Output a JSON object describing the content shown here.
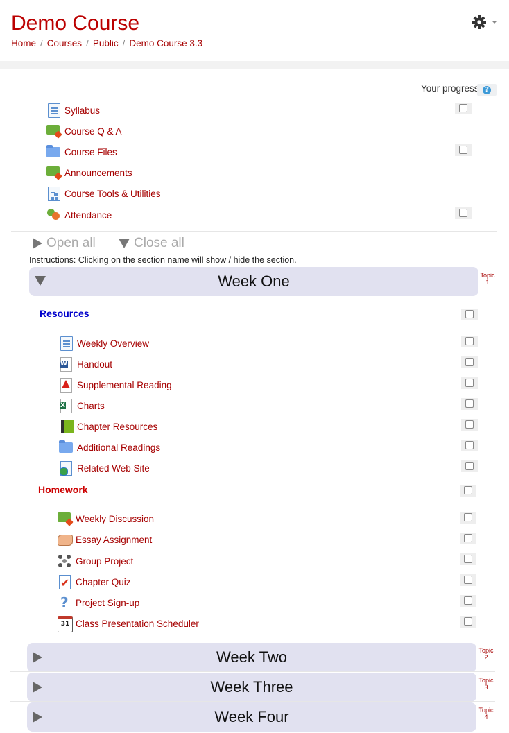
{
  "header": {
    "title": "Demo Course",
    "breadcrumb": [
      "Home",
      "Courses",
      "Public",
      "Demo Course 3.3"
    ]
  },
  "progress": {
    "label": "Your progress",
    "help": "?"
  },
  "top_activities": [
    {
      "label": "Syllabus",
      "icon": "page-icon",
      "has_checkbox": true
    },
    {
      "label": "Course Q & A",
      "icon": "forum-icon",
      "has_checkbox": false
    },
    {
      "label": "Course Files",
      "icon": "folder-icon",
      "has_checkbox": true
    },
    {
      "label": "Announcements",
      "icon": "forum-icon",
      "has_checkbox": false
    },
    {
      "label": "Course Tools & Utilities",
      "icon": "tools-page-icon",
      "has_checkbox": false
    },
    {
      "label": "Attendance",
      "icon": "attendance-icon",
      "has_checkbox": true
    }
  ],
  "controls": {
    "open_all": "Open all",
    "close_all": "Close all",
    "instructions": "Instructions: Clicking on the section name will show / hide the section."
  },
  "weeks": [
    {
      "title": "Week One",
      "topic": "Topic",
      "num": "1",
      "expanded": true
    },
    {
      "title": "Week Two",
      "topic": "Topic",
      "num": "2",
      "expanded": false
    },
    {
      "title": "Week Three",
      "topic": "Topic",
      "num": "3",
      "expanded": false
    },
    {
      "title": "Week Four",
      "topic": "Topic",
      "num": "4",
      "expanded": false
    }
  ],
  "resources": {
    "heading": "Resources",
    "color": "#0000cc",
    "items": [
      {
        "label": "Weekly Overview",
        "icon": "page-icon"
      },
      {
        "label": "Handout",
        "icon": "word-doc-icon"
      },
      {
        "label": "Supplemental Reading",
        "icon": "pdf-icon"
      },
      {
        "label": "Charts",
        "icon": "spreadsheet-icon"
      },
      {
        "label": "Chapter Resources",
        "icon": "book-icon"
      },
      {
        "label": "Additional Readings",
        "icon": "folder-icon"
      },
      {
        "label": "Related Web Site",
        "icon": "url-icon"
      }
    ]
  },
  "homework": {
    "heading": "Homework",
    "color": "#cc0000",
    "items": [
      {
        "label": "Weekly Discussion",
        "icon": "forum-icon"
      },
      {
        "label": "Essay Assignment",
        "icon": "assignment-icon"
      },
      {
        "label": "Group Project",
        "icon": "workshop-icon"
      },
      {
        "label": "Chapter Quiz",
        "icon": "quiz-icon"
      },
      {
        "label": "Project Sign-up",
        "icon": "question-icon"
      },
      {
        "label": "Class Presentation Scheduler",
        "icon": "calendar-icon"
      }
    ]
  },
  "colors": {
    "link": "#a60000",
    "title": "#bb0000",
    "week_bg": "#e1e1f0"
  }
}
